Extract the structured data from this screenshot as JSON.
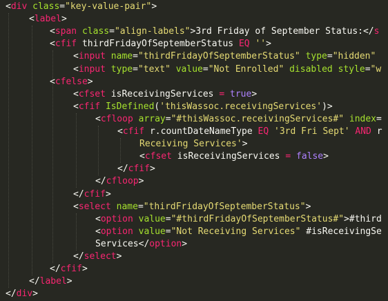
{
  "editor": {
    "colors": {
      "background": "#272822",
      "text": "#f8f8f2",
      "tag": "#f92672",
      "attribute": "#a6e22e",
      "string": "#e6db74",
      "constant": "#ae81ff",
      "indent_guide": "#4a4b42"
    },
    "lines": [
      [
        [
          "punct",
          "<"
        ],
        [
          "tag",
          "div"
        ],
        [
          "text",
          " "
        ],
        [
          "attr",
          "class"
        ],
        [
          "punct",
          "="
        ],
        [
          "str",
          "\"key-value-pair\""
        ],
        [
          "punct",
          ">"
        ]
      ],
      [
        [
          "punct",
          "<"
        ],
        [
          "tag",
          "label"
        ],
        [
          "punct",
          ">"
        ]
      ],
      [
        [
          "punct",
          "<"
        ],
        [
          "tag",
          "span"
        ],
        [
          "text",
          " "
        ],
        [
          "attr",
          "class"
        ],
        [
          "punct",
          "="
        ],
        [
          "str",
          "\"align-labels\""
        ],
        [
          "punct",
          ">"
        ],
        [
          "text",
          "3rd Friday of September Status:"
        ],
        [
          "punct",
          "</"
        ],
        [
          "tag",
          "s"
        ]
      ],
      [
        [
          "punct",
          "<"
        ],
        [
          "tag",
          "cfif"
        ],
        [
          "text",
          " thirdFridayOfSeptemberStatus "
        ],
        [
          "kw",
          "EQ"
        ],
        [
          "text",
          " "
        ],
        [
          "str",
          "''"
        ],
        [
          "punct",
          ">"
        ]
      ],
      [
        [
          "punct",
          "<"
        ],
        [
          "tag",
          "input"
        ],
        [
          "text",
          " "
        ],
        [
          "attr",
          "name"
        ],
        [
          "punct",
          "="
        ],
        [
          "str",
          "\"thirdFridayOfSeptemberStatus\""
        ],
        [
          "text",
          " "
        ],
        [
          "attr",
          "type"
        ],
        [
          "punct",
          "="
        ],
        [
          "str",
          "\"hidden\""
        ],
        [
          "text",
          " "
        ]
      ],
      [
        [
          "punct",
          "<"
        ],
        [
          "tag",
          "input"
        ],
        [
          "text",
          " "
        ],
        [
          "attr",
          "type"
        ],
        [
          "punct",
          "="
        ],
        [
          "str",
          "\"text\""
        ],
        [
          "text",
          " "
        ],
        [
          "attr",
          "value"
        ],
        [
          "punct",
          "="
        ],
        [
          "str",
          "\"Not Enrolled\""
        ],
        [
          "text",
          " "
        ],
        [
          "attr",
          "disabled"
        ],
        [
          "text",
          " "
        ],
        [
          "attr",
          "style"
        ],
        [
          "punct",
          "="
        ],
        [
          "str",
          "\"w"
        ]
      ],
      [
        [
          "punct",
          "<"
        ],
        [
          "tag",
          "cfelse"
        ],
        [
          "punct",
          ">"
        ]
      ],
      [
        [
          "punct",
          "<"
        ],
        [
          "tag",
          "cfset"
        ],
        [
          "text",
          " isReceivingServices "
        ],
        [
          "kw",
          "="
        ],
        [
          "text",
          " "
        ],
        [
          "const",
          "true"
        ],
        [
          "punct",
          ">"
        ]
      ],
      [
        [
          "punct",
          "<"
        ],
        [
          "tag",
          "cfif"
        ],
        [
          "text",
          " "
        ],
        [
          "attr",
          "IsDefined"
        ],
        [
          "punct",
          "("
        ],
        [
          "str",
          "'thisWassoc.receivingServices'"
        ],
        [
          "punct",
          ")>"
        ]
      ],
      [
        [
          "punct",
          "<"
        ],
        [
          "tag",
          "cfloop"
        ],
        [
          "text",
          " "
        ],
        [
          "attr",
          "array"
        ],
        [
          "punct",
          "="
        ],
        [
          "str",
          "\"#thisWassoc.receivingServices#\""
        ],
        [
          "text",
          " "
        ],
        [
          "attr",
          "index"
        ],
        [
          "punct",
          "="
        ]
      ],
      [
        [
          "punct",
          "<"
        ],
        [
          "tag",
          "cfif"
        ],
        [
          "text",
          " r.countDateNameType "
        ],
        [
          "kw",
          "EQ"
        ],
        [
          "text",
          " "
        ],
        [
          "str",
          "'3rd Fri Sept'"
        ],
        [
          "text",
          " "
        ],
        [
          "kw",
          "AND"
        ],
        [
          "text",
          " r"
        ]
      ],
      [
        [
          "str",
          "Receiving Services'"
        ],
        [
          "punct",
          ">"
        ]
      ],
      [
        [
          "punct",
          "<"
        ],
        [
          "tag",
          "cfset"
        ],
        [
          "text",
          " isReceivingServices "
        ],
        [
          "kw",
          "="
        ],
        [
          "text",
          " "
        ],
        [
          "const",
          "false"
        ],
        [
          "punct",
          ">"
        ]
      ],
      [
        [
          "punct",
          "</"
        ],
        [
          "tag",
          "cfif"
        ],
        [
          "punct",
          ">"
        ]
      ],
      [
        [
          "punct",
          "</"
        ],
        [
          "tag",
          "cfloop"
        ],
        [
          "punct",
          ">"
        ]
      ],
      [
        [
          "punct",
          "</"
        ],
        [
          "tag",
          "cfif"
        ],
        [
          "punct",
          ">"
        ]
      ],
      [
        [
          "punct",
          "<"
        ],
        [
          "tag",
          "select"
        ],
        [
          "text",
          " "
        ],
        [
          "attr",
          "name"
        ],
        [
          "punct",
          "="
        ],
        [
          "str",
          "\"thirdFridayOfSeptemberStatus\""
        ],
        [
          "punct",
          ">"
        ]
      ],
      [
        [
          "punct",
          "<"
        ],
        [
          "tag",
          "option"
        ],
        [
          "text",
          " "
        ],
        [
          "attr",
          "value"
        ],
        [
          "punct",
          "="
        ],
        [
          "str",
          "\"#thirdFridayOfSeptemberStatus#\""
        ],
        [
          "punct",
          ">"
        ],
        [
          "text",
          "#third"
        ]
      ],
      [
        [
          "punct",
          "<"
        ],
        [
          "tag",
          "option"
        ],
        [
          "text",
          " "
        ],
        [
          "attr",
          "value"
        ],
        [
          "punct",
          "="
        ],
        [
          "str",
          "\"Not Receiving Services\""
        ],
        [
          "text",
          " #isReceivingSe"
        ]
      ],
      [
        [
          "text",
          "Services"
        ],
        [
          "punct",
          "</"
        ],
        [
          "tag",
          "option"
        ],
        [
          "punct",
          ">"
        ]
      ],
      [
        [
          "punct",
          "</"
        ],
        [
          "tag",
          "select"
        ],
        [
          "punct",
          ">"
        ]
      ],
      [
        [
          "punct",
          "</"
        ],
        [
          "tag",
          "cfif"
        ],
        [
          "punct",
          ">"
        ]
      ],
      [
        [
          "punct",
          "</"
        ],
        [
          "tag",
          "label"
        ],
        [
          "punct",
          ">"
        ]
      ],
      [
        [
          "punct",
          "</"
        ],
        [
          "tag",
          "div"
        ],
        [
          "punct",
          ">"
        ]
      ]
    ]
  }
}
